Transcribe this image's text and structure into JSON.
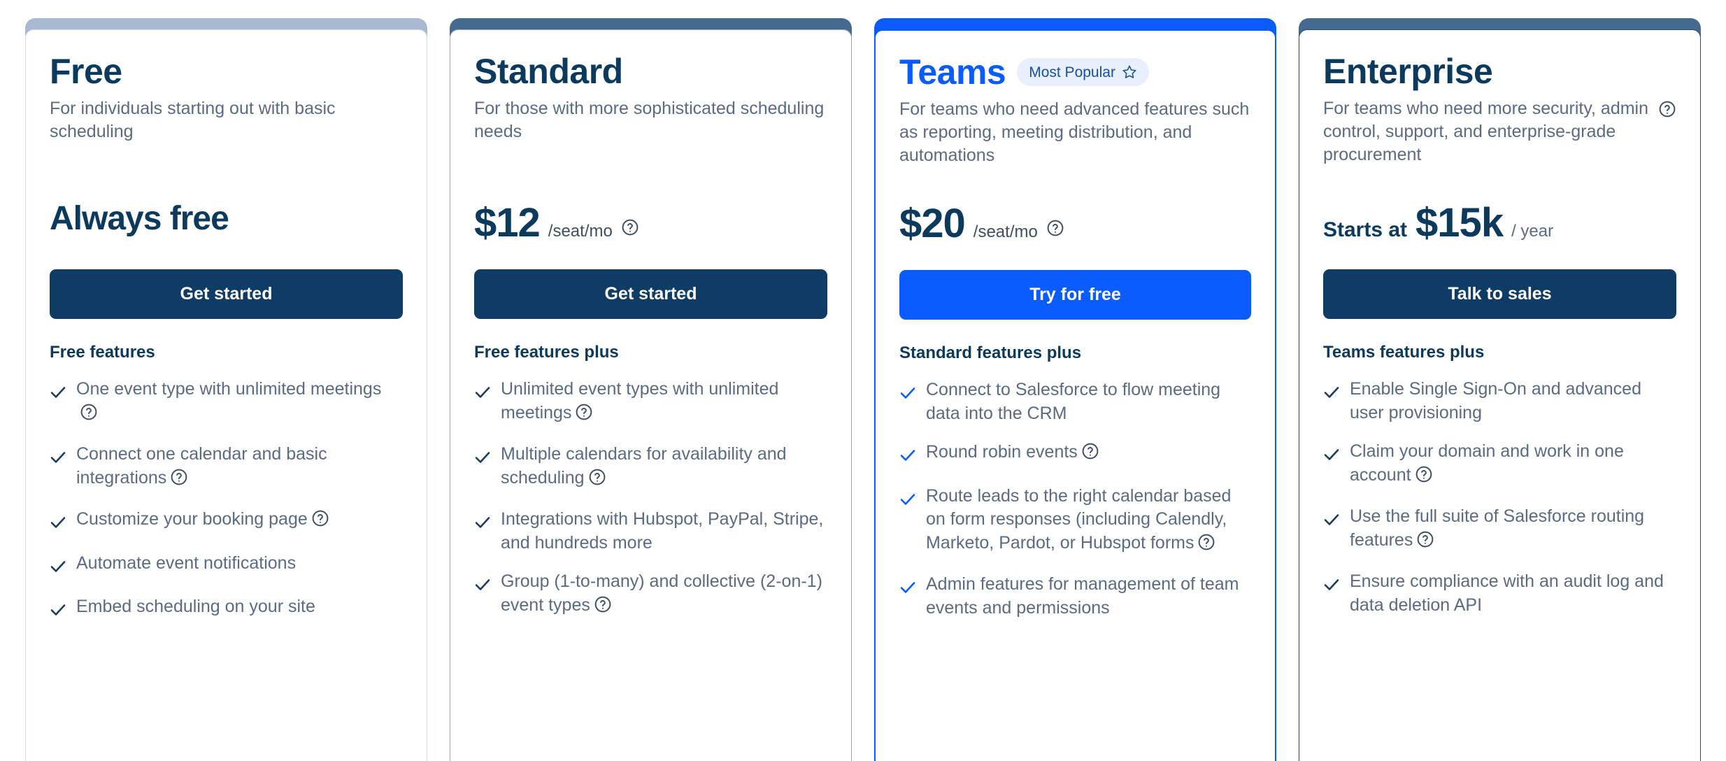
{
  "colors": {
    "navy": "#0b3a5d",
    "slate": "#446a8f",
    "light_slate": "#a9b9d1",
    "blue": "#0b5cff",
    "body_text": "#5a6b82",
    "badge_bg": "#e8f0fe",
    "badge_text": "#1b4fa0"
  },
  "plans": [
    {
      "id": "free",
      "name": "Free",
      "badge": null,
      "description": "For individuals starting out with basic scheduling",
      "description_help_icon": null,
      "price": {
        "prefix": null,
        "amount": "Always free",
        "amount_is_text": true,
        "unit": null,
        "help_icon": null
      },
      "cta": {
        "label": "Get started",
        "style": "navy"
      },
      "features_title": "Free features",
      "features": [
        {
          "text": "One event type with unlimited meetings",
          "help_icon": "help-circle-icon"
        },
        {
          "text": "Connect one calendar and basic integrations",
          "help_icon": "help-circle-icon"
        },
        {
          "text": "Customize your booking page",
          "help_icon": "help-circle-icon"
        },
        {
          "text": "Automate event notifications",
          "help_icon": null
        },
        {
          "text": "Embed scheduling on your site",
          "help_icon": null
        }
      ],
      "cap_color": "#a9b9d1",
      "border_color": "#d3dbe6",
      "check_color": "#1b3c5c",
      "title_color": "#0b3a5d"
    },
    {
      "id": "standard",
      "name": "Standard",
      "badge": null,
      "description": "For those with more sophisticated scheduling needs",
      "description_help_icon": null,
      "price": {
        "prefix": null,
        "amount": "$12",
        "amount_is_text": false,
        "unit": "/seat/mo",
        "help_icon": "help-circle-icon"
      },
      "cta": {
        "label": "Get started",
        "style": "navy"
      },
      "features_title": "Free features plus",
      "features": [
        {
          "text": "Unlimited event types with unlimited meetings",
          "help_icon": "help-circle-icon"
        },
        {
          "text": "Multiple calendars for availability and scheduling",
          "help_icon": "help-circle-icon"
        },
        {
          "text": "Integrations with Hubspot, PayPal, Stripe, and hundreds more",
          "help_icon": null
        },
        {
          "text": "Group (1-to-many) and collective (2-on-1) event types",
          "help_icon": "help-circle-icon"
        }
      ],
      "cap_color": "#446a8f",
      "border_color": "#9aa9bd",
      "check_color": "#1b3c5c",
      "title_color": "#0b3a5d"
    },
    {
      "id": "teams",
      "name": "Teams",
      "badge": {
        "label": "Most Popular",
        "icon": "star-icon"
      },
      "description": "For teams who need advanced features such as reporting, meeting distribution, and automations",
      "description_help_icon": null,
      "price": {
        "prefix": null,
        "amount": "$20",
        "amount_is_text": false,
        "unit": "/seat/mo",
        "help_icon": "help-circle-icon"
      },
      "cta": {
        "label": "Try for free",
        "style": "blue"
      },
      "features_title": "Standard features plus",
      "features": [
        {
          "text": "Connect to Salesforce to flow meeting data into the CRM",
          "help_icon": null
        },
        {
          "text": "Round robin events",
          "help_icon": "help-circle-icon"
        },
        {
          "text": "Route leads to the right calendar based on form responses (including Calendly, Marketo, Pardot, or Hubspot forms",
          "help_icon": "help-circle-icon"
        },
        {
          "text": "Admin features for management of team events and permissions",
          "help_icon": null
        }
      ],
      "cap_color": "#0b5cff",
      "border_color": "#0b5cff",
      "check_color": "#0b5cff",
      "title_color": "#0b5cff"
    },
    {
      "id": "enterprise",
      "name": "Enterprise",
      "badge": null,
      "description": "For teams who need more security, admin control, support, and enterprise-grade procurement",
      "description_help_icon": "help-circle-icon",
      "price": {
        "prefix": "Starts at",
        "amount": "$15k",
        "amount_is_text": false,
        "unit": "/ year",
        "help_icon": null
      },
      "cta": {
        "label": "Talk to sales",
        "style": "navy"
      },
      "features_title": "Teams features plus",
      "features": [
        {
          "text": "Enable Single Sign-On and advanced user provisioning",
          "help_icon": null
        },
        {
          "text": "Claim your domain and work in one account",
          "help_icon": "help-circle-icon"
        },
        {
          "text": "Use the full suite of Salesforce routing features",
          "help_icon": "help-circle-icon"
        },
        {
          "text": "Ensure compliance with an audit log and data deletion API",
          "help_icon": null
        }
      ],
      "cap_color": "#446a8f",
      "border_color": "#2c4a6b",
      "check_color": "#1b3c5c",
      "title_color": "#0b3a5d"
    }
  ]
}
